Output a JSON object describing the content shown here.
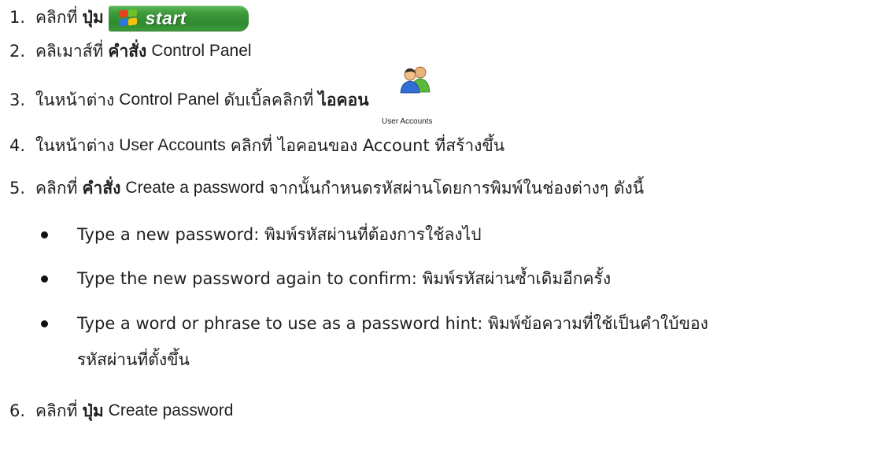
{
  "steps": [
    {
      "num": "1.",
      "text": "คลิกที่",
      "bold": "ปุ่ม",
      "start_button_label": "start"
    },
    {
      "num": "2.",
      "text": "คลิเมาส์ที่",
      "bold": "คำสั่ง",
      "after": "Control Panel"
    },
    {
      "num": "3.",
      "text": "ในหน้าต่าง",
      "en": "Control Panel",
      "after": "ดับเบิ้ลคลิกที่",
      "bold": "ไอคอน",
      "icon_caption": "User Accounts"
    },
    {
      "num": "4.",
      "text": "ในหน้าต่าง",
      "en": "User Accounts",
      "after": "คลิกที่ ไอคอนของ Account ที่สร้างขึ้น"
    },
    {
      "num": "5.",
      "text": "คลิกที่",
      "bold": "คำสั่ง",
      "en": "Create a password",
      "after": "จากนั้นกำหนดรหัสผ่านโดยการพิมพ์ในช่องต่างๆ ดังนี้"
    },
    {
      "num": "6.",
      "text": "คลิกที่",
      "bold": "ปุ่ม",
      "en": "Create password"
    }
  ],
  "bullets": [
    "Type a new password: พิมพ์รหัสผ่านที่ต้องการใช้ลงไป",
    "Type the new password again to confirm: พิมพ์รหัสผ่านซ้ำเดิมอีกครั้ง",
    "Type a word or phrase to use as a password hint: พิมพ์ข้อความที่ใช้เป็นคำใบ้ของ",
    "รหัสผ่านที่ตั้งขึ้น"
  ],
  "colors": {
    "start_green": "#3c9a3a",
    "text": "#1f1f1f"
  },
  "icons": {
    "start_flag": "windows-flag-icon",
    "user_accounts": "user-accounts-icon"
  }
}
